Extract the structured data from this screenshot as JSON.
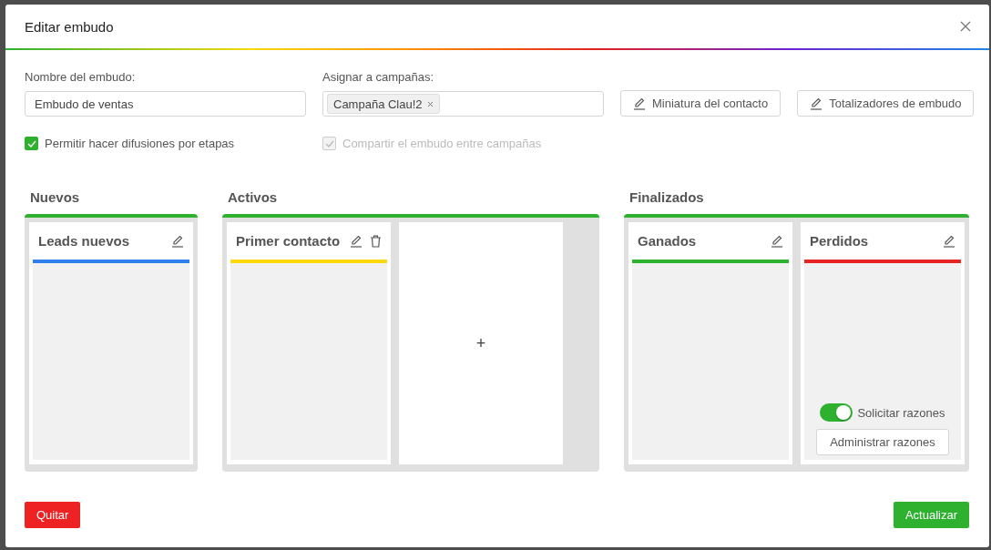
{
  "dialog": {
    "title": "Editar embudo"
  },
  "form": {
    "name_label": "Nombre del embudo:",
    "name_value": "Embudo de ventas",
    "campaigns_label": "Asignar a campañas:",
    "campaigns": [
      {
        "label": "Campaña Clau!2"
      }
    ],
    "buttons": [
      {
        "label": "Miniatura del contacto"
      },
      {
        "label": "Totalizadores de embudo"
      }
    ],
    "options": [
      {
        "label": "Permitir hacer difusiones por etapas",
        "checked": true,
        "disabled": false
      },
      {
        "label": "Compartir el embudo entre campañas",
        "checked": true,
        "disabled": true
      }
    ]
  },
  "groups": [
    {
      "title": "Nuevos",
      "stages": [
        {
          "kind": "stage",
          "name": "Leads nuevos",
          "color": "#2f80ed",
          "deletable": false
        }
      ]
    },
    {
      "title": "Activos",
      "stages": [
        {
          "kind": "stage",
          "name": "Primer contacto",
          "color": "#fdd80f",
          "deletable": true
        },
        {
          "kind": "add",
          "label": "+"
        }
      ]
    },
    {
      "title": "Finalizados",
      "stages": [
        {
          "kind": "stage",
          "name": "Ganados",
          "color": "#2db12f",
          "deletable": false
        },
        {
          "kind": "stage",
          "name": "Perdidos",
          "color": "#e82323",
          "deletable": false,
          "reasons": {
            "label": "Solicitar razones",
            "on": true,
            "button": "Administrar razones"
          }
        }
      ]
    }
  ],
  "footer": {
    "delete": "Quitar",
    "submit": "Actualizar"
  }
}
